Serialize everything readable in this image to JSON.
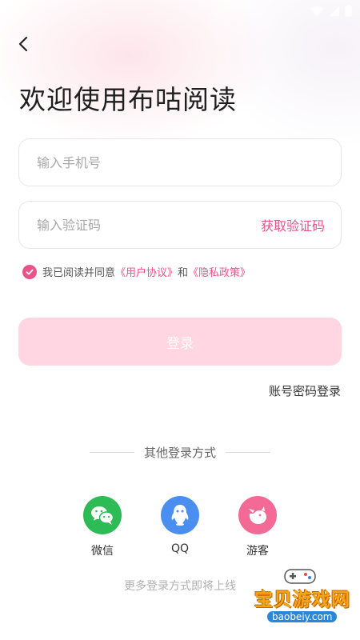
{
  "header": {
    "title": "欢迎使用布咕阅读"
  },
  "form": {
    "phone_placeholder": "输入手机号",
    "code_placeholder": "输入验证码",
    "get_code": "获取验证码"
  },
  "agreement": {
    "prefix": "我已阅读并同意",
    "user_agreement": "《用户协议》",
    "and": "和",
    "privacy_policy": "《隐私政策》",
    "checked": true
  },
  "login_button": "登录",
  "password_login": "账号密码登录",
  "other_login": {
    "label": "其他登录方式",
    "options": [
      {
        "label": "微信",
        "icon": "wechat-icon",
        "color": "#2dbb55"
      },
      {
        "label": "QQ",
        "icon": "qq-icon",
        "color": "#4a8ff0"
      },
      {
        "label": "游客",
        "icon": "guest-icon",
        "color": "#f26a95"
      }
    ]
  },
  "more_text": "更多登录方式即将上线",
  "watermark": {
    "text": "宝贝游戏网",
    "url": "baobeiy.com"
  },
  "colors": {
    "accent": "#e8538a",
    "button_disabled": "#ffd6e1"
  }
}
